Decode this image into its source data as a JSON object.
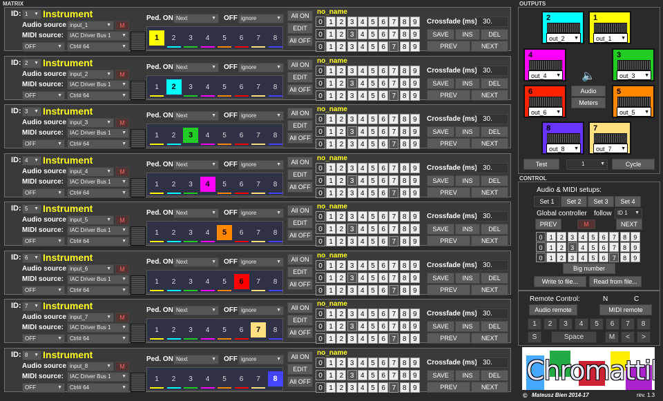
{
  "sections": {
    "matrix": "MATRIX",
    "outputs": "OUTPUTS",
    "control": "CONTROL"
  },
  "labels": {
    "id": "ID:",
    "instrument": "Instrument",
    "audio_source": "Audio source:",
    "midi_source": "MIDI source:",
    "ped_on": "Ped. ON",
    "off": "OFF",
    "crossfade": "Crossfade (ms):",
    "all_on": "All ON",
    "edit": "EDIT",
    "all_off": "All OFF",
    "save": "SAVE",
    "ins": "INS",
    "del": "DEL",
    "prev": "PREV",
    "next": "NEXT",
    "m": "M",
    "next_opt": "Next",
    "ignore_opt": "ignore",
    "midi_bus": "IAC Driver Bus 1",
    "ctrl": "Ctrl# 64",
    "off_opt": "OFF",
    "no_name": "no_name",
    "crossfade_val": "30."
  },
  "pedal_numbers": [
    "1",
    "2",
    "3",
    "4",
    "5",
    "6",
    "7",
    "8"
  ],
  "grid_numbers": [
    "0",
    "1",
    "2",
    "3",
    "4",
    "5",
    "6",
    "7",
    "8",
    "9"
  ],
  "pedal_colors": [
    "#ffff00",
    "#00ffff",
    "#22cc22",
    "#ff00ff",
    "#ff8800",
    "#ff0000",
    "#ffe080",
    "#4444ff"
  ],
  "rows": [
    {
      "id": "1",
      "input": "input_1",
      "active": 0
    },
    {
      "id": "2",
      "input": "input_2",
      "active": 1
    },
    {
      "id": "3",
      "input": "input_3",
      "active": 2
    },
    {
      "id": "4",
      "input": "input_4",
      "active": 3
    },
    {
      "id": "5",
      "input": "input_5",
      "active": 4
    },
    {
      "id": "6",
      "input": "input_6",
      "active": 5
    },
    {
      "id": "7",
      "input": "input_7",
      "active": 6
    },
    {
      "id": "8",
      "input": "input_8",
      "active": 7
    }
  ],
  "outputs": [
    {
      "num": "2",
      "label": "out_2",
      "color": "#00ffff"
    },
    {
      "num": "1",
      "label": "out_1",
      "color": "#ffff00"
    },
    {
      "num": "4",
      "label": "out_4",
      "color": "#ff00ff"
    },
    {
      "num": "3",
      "label": "out_3",
      "color": "#22cc22"
    },
    {
      "num": "6",
      "label": "out_6",
      "color": "#ff2200"
    },
    {
      "num": "5",
      "label": "out_5",
      "color": "#ff8800"
    },
    {
      "num": "8",
      "label": "out_8",
      "color": "#6633ff"
    },
    {
      "num": "7",
      "label": "out_7",
      "color": "#ffe080"
    }
  ],
  "outputs_panel": {
    "audio": "Audio",
    "meters": "Meters",
    "test": "Test",
    "cycle": "Cycle",
    "channel": "1"
  },
  "control": {
    "setups": "Audio & MIDI setups:",
    "sets": [
      "Set 1",
      "Set 2",
      "Set 3",
      "Set 4"
    ],
    "global": "Global controller",
    "follow": "follow",
    "id_sel": "ID 1",
    "prev": "PREV",
    "m": "M",
    "next": "NEXT",
    "big_number": "Big number",
    "write": "Write to file...",
    "read": "Read from file..."
  },
  "remote": {
    "title": "Remote Control:",
    "n": "N",
    "c": "C",
    "audio_remote": "Audio remote",
    "midi_remote": "MIDI remote",
    "keys": [
      "1",
      "2",
      "3",
      "4",
      "5",
      "6",
      "7",
      "8"
    ],
    "s": "S",
    "space": "Space",
    "m": "M",
    "lt": "<",
    ">": ">",
    "gt": ">"
  },
  "logo": "Chromattik",
  "footer": {
    "copyright": "©",
    "author": "Mateusz Bien 2014-17",
    "rev": "rev. 1.3"
  }
}
